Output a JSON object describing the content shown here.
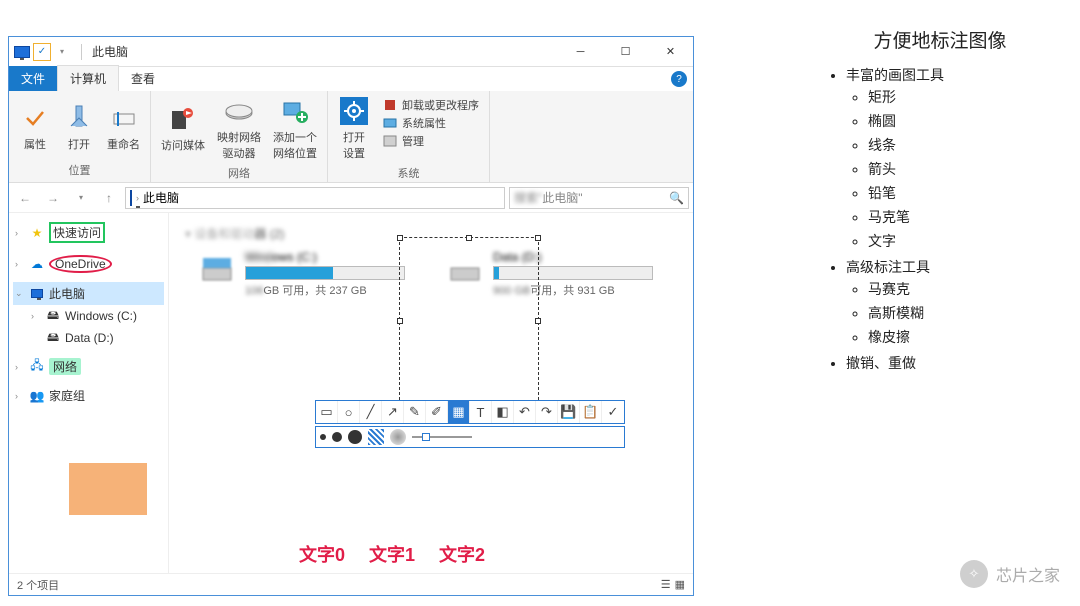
{
  "window": {
    "title": "此电脑"
  },
  "tabs": {
    "file": "文件",
    "computer": "计算机",
    "view": "查看"
  },
  "ribbon": {
    "location": {
      "label": "位置",
      "properties": "属性",
      "open": "打开",
      "rename": "重命名"
    },
    "network": {
      "label": "网络",
      "media": "访问媒体",
      "map_drive": "映射网络\n驱动器",
      "add_location": "添加一个\n网络位置"
    },
    "system": {
      "label": "系统",
      "open_settings": "打开\n设置",
      "uninstall": "卸载或更改程序",
      "sys_props": "系统属性",
      "manage": "管理"
    }
  },
  "address": {
    "path": "此电脑"
  },
  "search": {
    "placeholder": "此电脑\""
  },
  "sidebar": {
    "quick_access": "快速访问",
    "onedrive": "OneDrive",
    "this_pc": "此电脑",
    "win_c": "Windows (C:)",
    "data_d": "Data (D:)",
    "network": "网络",
    "homegroup": "家庭组"
  },
  "content": {
    "group_header": "器 (2)",
    "drive_c": {
      "name": "ows (C:)",
      "free": "GB 可用，共 237 GB",
      "fill": 55
    },
    "drive_d": {
      "free": "可用，共 931 GB",
      "fill": 3
    }
  },
  "text_annotations": {
    "t0": "文字0",
    "t1": "文字1",
    "t2": "文字2"
  },
  "statusbar": {
    "items": "2 个项目"
  },
  "right_panel": {
    "title": "方便地标注图像",
    "items": {
      "a": "丰富的画图工具",
      "a1": "矩形",
      "a2": "椭圆",
      "a3": "线条",
      "a4": "箭头",
      "a5": "铅笔",
      "a6": "马克笔",
      "a7": "文字",
      "b": "高级标注工具",
      "b1": "马赛克",
      "b2": "高斯模糊",
      "b3": "橡皮擦",
      "c": "撤销、重做"
    }
  },
  "watermark": {
    "text": "芯片之家"
  }
}
